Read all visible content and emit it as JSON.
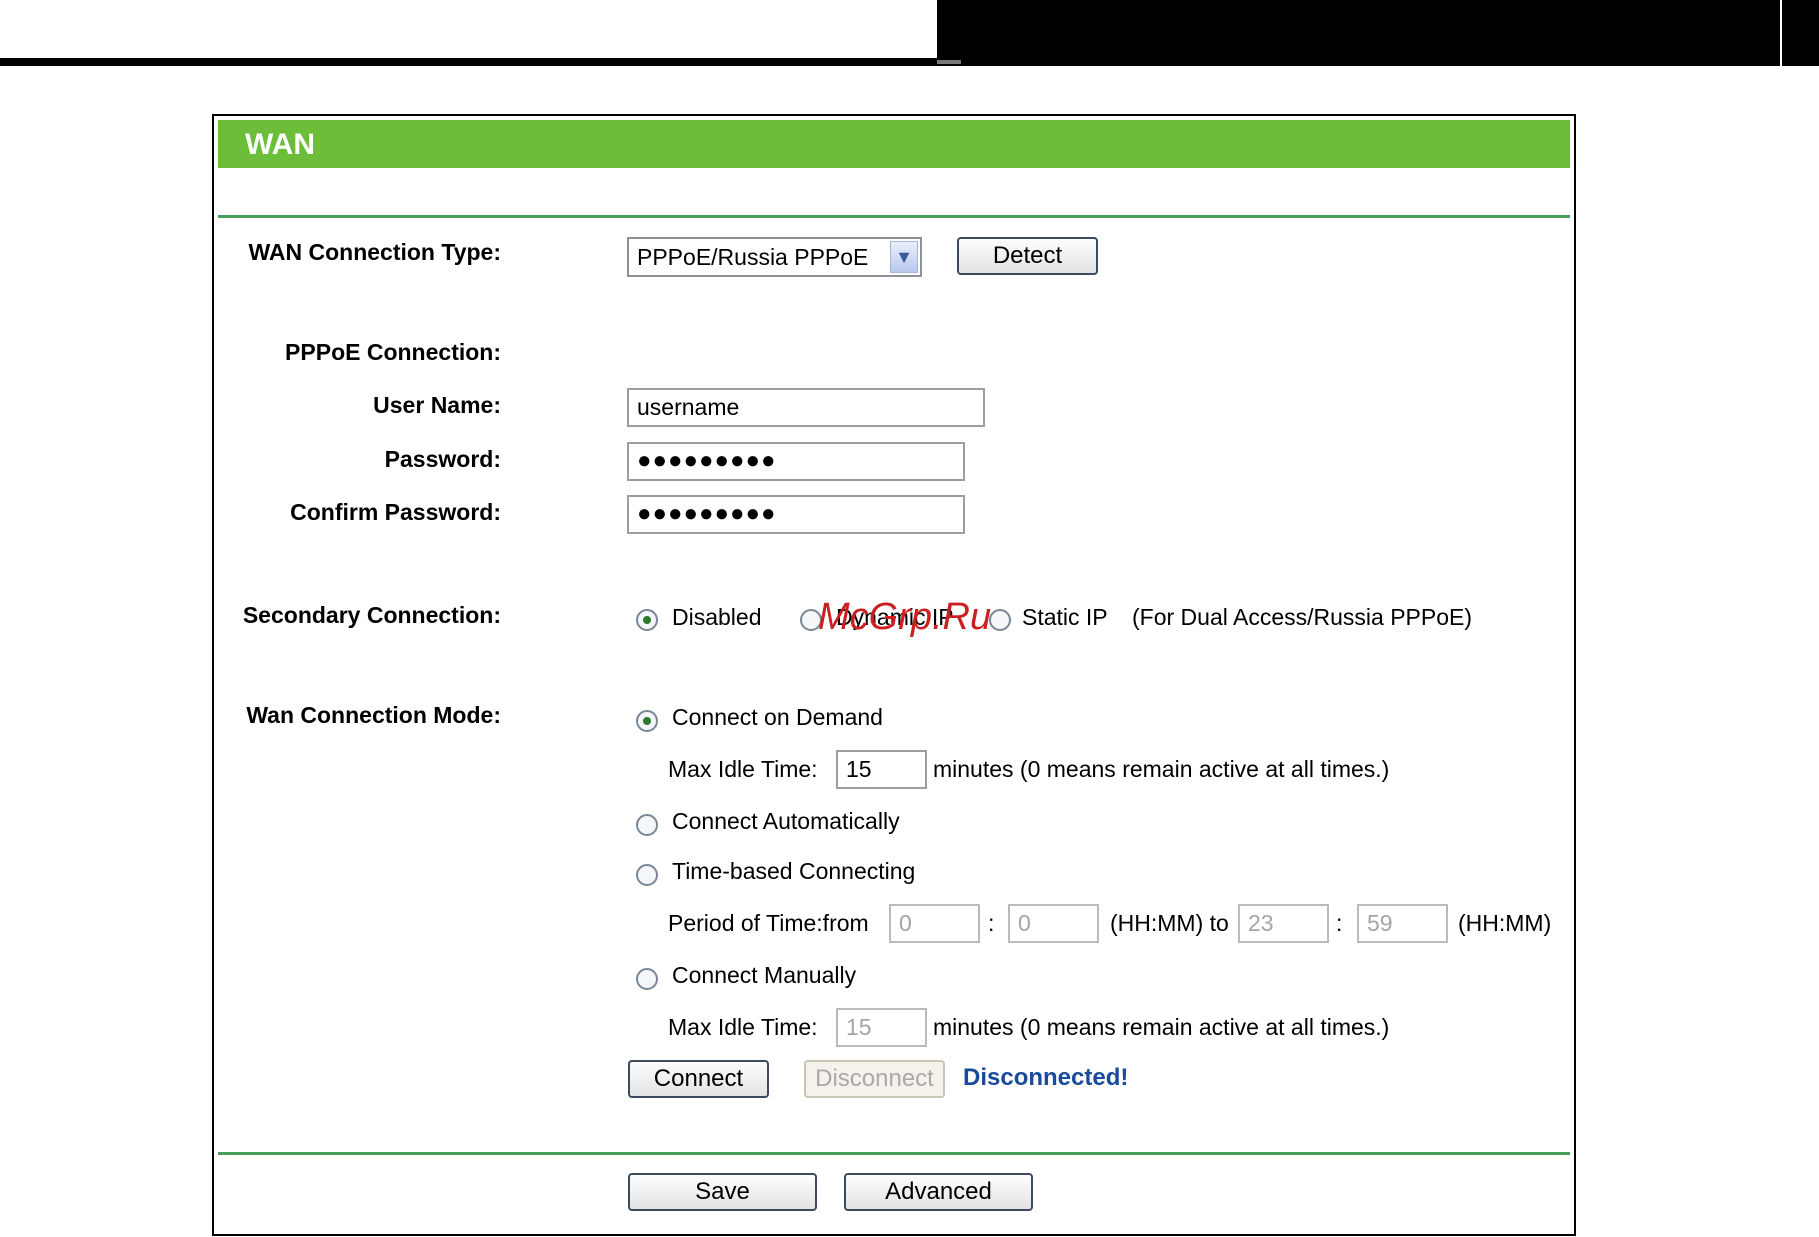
{
  "page": {
    "title": "WAN"
  },
  "wan_type": {
    "label": "WAN Connection Type:",
    "value": "PPPoE/Russia PPPoE",
    "detect_label": "Detect"
  },
  "pppoe": {
    "section_label": "PPPoE Connection:",
    "username_label": "User Name:",
    "username_value": "username",
    "password_label": "Password:",
    "password_value": "●●●●●●●●●",
    "confirm_label": "Confirm Password:",
    "confirm_value": "●●●●●●●●●"
  },
  "secondary": {
    "label": "Secondary Connection:",
    "options": [
      "Disabled",
      "Dynamic IP",
      "Static IP"
    ],
    "selected": "Disabled",
    "note": "(For Dual Access/Russia PPPoE)"
  },
  "mode": {
    "label": "Wan Connection Mode:",
    "on_demand": "Connect on Demand",
    "max_idle_label": "Max Idle Time:",
    "max_idle_value": "15",
    "minutes_note": "minutes (0 means remain active at all times.)",
    "auto": "Connect Automatically",
    "time_based": "Time-based Connecting",
    "period_label": "Period of Time:from",
    "from_hh": "0",
    "from_mm": "0",
    "hhmm_to": "(HH:MM) to",
    "to_hh": "23",
    "to_mm": "59",
    "hhmm": "(HH:MM)",
    "colon": ":",
    "manual": "Connect Manually",
    "manual_idle_value": "15",
    "selected": "Connect on Demand"
  },
  "actions": {
    "connect": "Connect",
    "disconnect": "Disconnect",
    "status": "Disconnected!"
  },
  "footer": {
    "save": "Save",
    "advanced": "Advanced"
  },
  "watermark": "McGrp.Ru"
}
